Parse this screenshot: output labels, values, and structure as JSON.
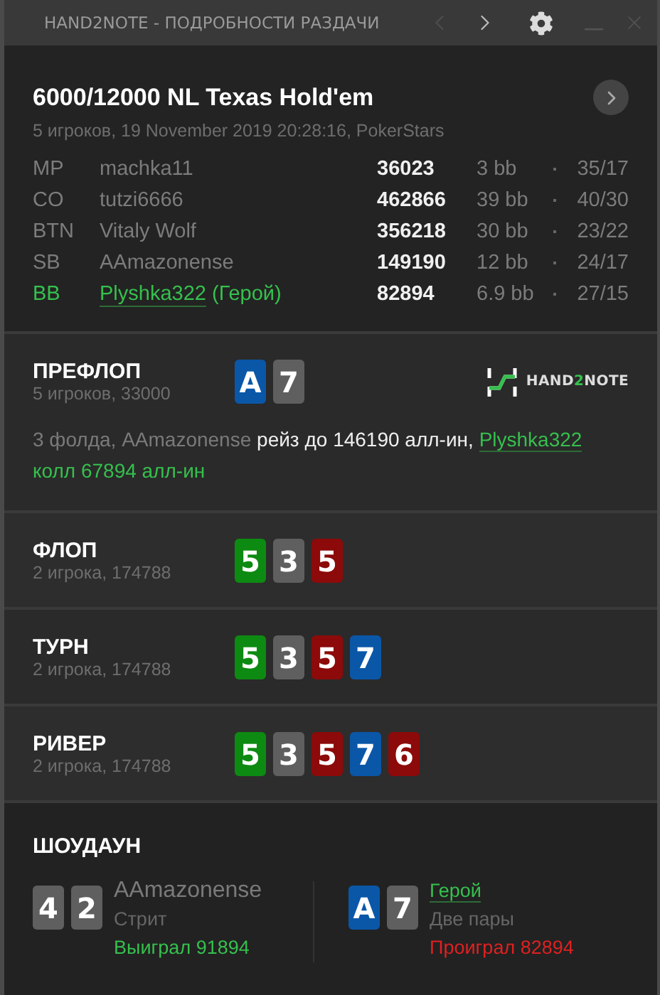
{
  "window": {
    "title": "HAND2NOTE - ПОДРОБНОСТИ РАЗДАЧИ",
    "nav": [
      {
        "kind": "prev",
        "disabled": true
      },
      {
        "kind": "next",
        "disabled": false
      }
    ]
  },
  "hand": {
    "title": "6000/12000 NL Texas Hold'em",
    "subtitle": "5 игроков, 19 November 2019 20:28:16, PokerStars",
    "players": [
      {
        "position": "MP",
        "name": "machka11",
        "hero": false,
        "stack": "36023",
        "bb": "3 bb",
        "stats": "35/17"
      },
      {
        "position": "CO",
        "name": "tutzi6666",
        "hero": false,
        "stack": "462866",
        "bb": "39 bb",
        "stats": "40/30"
      },
      {
        "position": "BTN",
        "name": "Vitaly Wolf",
        "hero": false,
        "stack": "356218",
        "bb": "30 bb",
        "stats": "23/22"
      },
      {
        "position": "SB",
        "name": "AAmazonense",
        "hero": false,
        "stack": "149190",
        "bb": "12 bb",
        "stats": "24/17"
      },
      {
        "position": "BB",
        "name": "Plyshka322",
        "hero_tag": "(Герой)",
        "hero": true,
        "stack": "82894",
        "bb": "6.9 bb",
        "stats": "27/15"
      }
    ]
  },
  "streets": [
    {
      "name": "ПРЕФЛОП",
      "info": "5 игроков, 33000",
      "cards": [
        {
          "rank": "A",
          "color": "#0a57a8"
        },
        {
          "rank": "7",
          "color": "#5f5f5f"
        }
      ],
      "logo": {
        "before": "HAND",
        "accent": "2",
        "after": "NOTE"
      },
      "action": [
        {
          "kind": "muted",
          "text": "3 фолда, AAmazonense"
        },
        {
          "kind": "bright",
          "text": "рейз до 146190 алл-ин,"
        },
        {
          "kind": "hero-link",
          "text": "Plyshka322"
        },
        {
          "kind": "hero",
          "text": "колл 67894 алл-ин"
        }
      ]
    },
    {
      "name": "ФЛОП",
      "info": "2 игрока, 174788",
      "cards": [
        {
          "rank": "5",
          "color": "#0d8a12"
        },
        {
          "rank": "3",
          "color": "#5f5f5f"
        },
        {
          "rank": "5",
          "color": "#8c0a0a"
        }
      ]
    },
    {
      "name": "ТУРН",
      "info": "2 игрока, 174788",
      "cards": [
        {
          "rank": "5",
          "color": "#0d8a12"
        },
        {
          "rank": "3",
          "color": "#5f5f5f"
        },
        {
          "rank": "5",
          "color": "#8c0a0a"
        },
        {
          "rank": "7",
          "color": "#0a57a8"
        }
      ]
    },
    {
      "name": "РИВЕР",
      "info": "2 игрока, 174788",
      "cards": [
        {
          "rank": "5",
          "color": "#0d8a12"
        },
        {
          "rank": "3",
          "color": "#5f5f5f"
        },
        {
          "rank": "5",
          "color": "#8c0a0a"
        },
        {
          "rank": "7",
          "color": "#0a57a8"
        },
        {
          "rank": "6",
          "color": "#8c0a0a"
        }
      ]
    }
  ],
  "showdown": {
    "title": "ШОУДАУН",
    "hands": [
      {
        "cards": [
          {
            "rank": "4",
            "color": "#5f5f5f"
          },
          {
            "rank": "2",
            "color": "#5f5f5f"
          }
        ],
        "player": "AAmazonense",
        "hero": false,
        "combo": "Стрит",
        "kind": "won",
        "result_text": "Выиграл 91894"
      },
      {
        "cards": [
          {
            "rank": "A",
            "color": "#0a57a8"
          },
          {
            "rank": "7",
            "color": "#5f5f5f"
          }
        ],
        "player": "Герой",
        "hero": true,
        "combo": "Две пары",
        "kind": "lost",
        "result_text": "Проиграл 82894"
      }
    ]
  }
}
